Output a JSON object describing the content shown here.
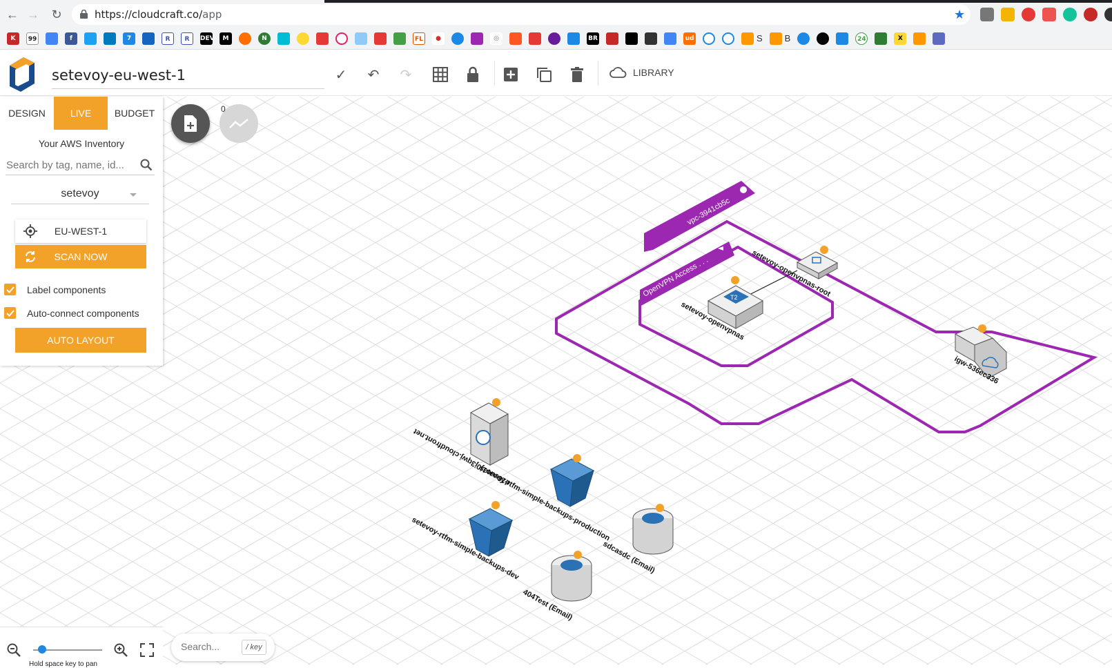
{
  "browser": {
    "url_host": "https://cloudcraft.co/",
    "url_path": "app",
    "bookmarks_text": [
      "S",
      "B"
    ]
  },
  "header": {
    "title": "setevoy-eu-west-1",
    "library_label": "LIBRARY"
  },
  "panel": {
    "tabs": [
      "DESIGN",
      "LIVE",
      "BUDGET"
    ],
    "active_tab": "LIVE",
    "inventory_title": "Your AWS Inventory",
    "search_placeholder": "Search by tag, name, id...",
    "account": "setevoy",
    "region": "EU-WEST-1",
    "scan_label": "SCAN NOW",
    "label_components": "Label components",
    "auto_connect": "Auto-connect components",
    "auto_layout": "AUTO LAYOUT"
  },
  "fab": {
    "count": "0"
  },
  "diagram": {
    "vpc_label": "vpc-3941cb5c",
    "subnet_label": "OpenVPN Access . . .",
    "ec2_label": "setevoy-openvpnas",
    "ec2_badge": "T2",
    "ebs_label": "setevoy-openvpnas-root",
    "igw_label": "igw-536ec336",
    "cloudfront_label": "d16suo1j0j3qwj.cloudfront.net",
    "s3_prod_label": "setevoy-rtfm-simple-backups-production",
    "s3_dev_label": "setevoy-rtfm-simple-backups-dev",
    "sns1_label": "sdcasdc (Email)",
    "sns2_label": "404Test (Email)"
  },
  "bottom": {
    "hint": "Hold space key to pan",
    "search_placeholder": "Search...",
    "key_hint": "/ key"
  },
  "colors": {
    "accent": "#f3a229",
    "vpc": "#9c27b0",
    "aws_blue": "#2a72b5"
  }
}
